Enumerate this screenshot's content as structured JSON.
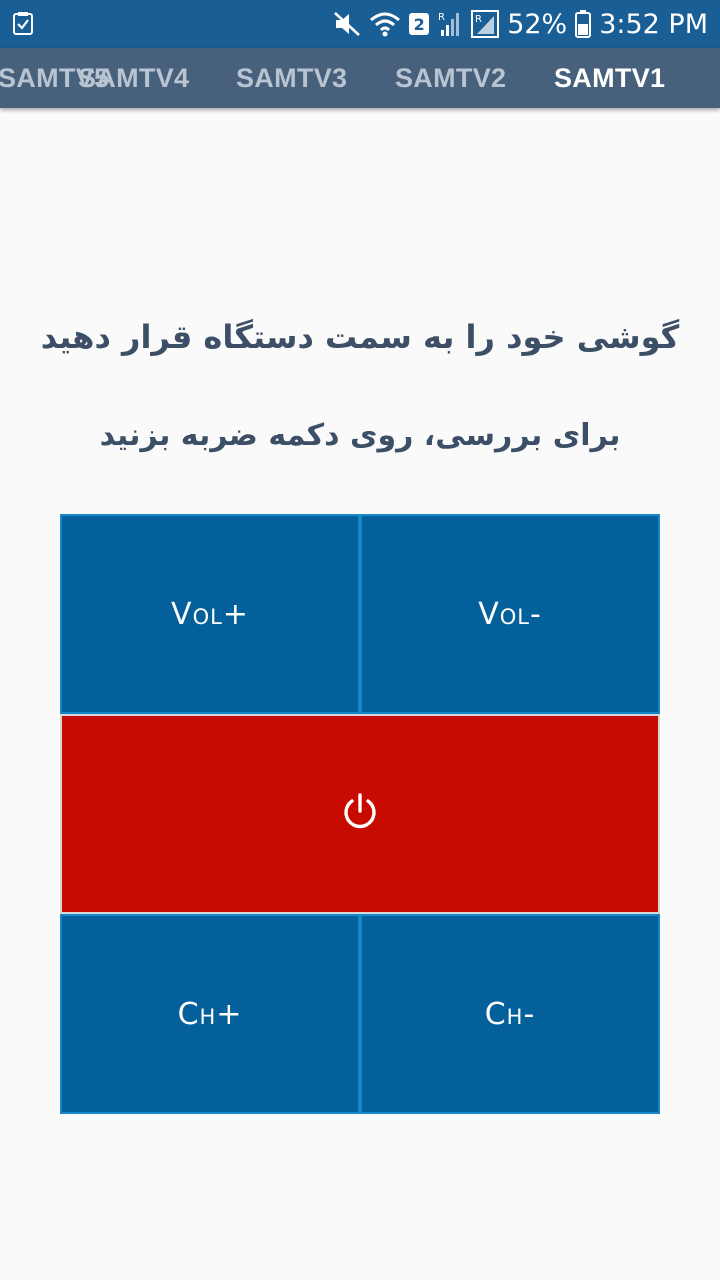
{
  "status_bar": {
    "left_icon": "clipboard-check-icon",
    "icons": [
      "mute-icon",
      "wifi-icon",
      "sim-2-badge",
      "signal-r-icon",
      "signal-r-icon",
      "battery-icon"
    ],
    "sim_badge": "2",
    "battery": "52%",
    "time": "3:52 PM"
  },
  "tabs": [
    {
      "label": "SAMTV5",
      "active": false
    },
    {
      "label": "SAMTV4",
      "active": false
    },
    {
      "label": "SAMTV3",
      "active": false
    },
    {
      "label": "SAMTV2",
      "active": false
    },
    {
      "label": "SAMTV1",
      "active": true
    }
  ],
  "instructions": {
    "line1": "گوشی خود را به سمت دستگاه قرار دهید",
    "line2": "برای بررسی، روی دکمه ضربه بزنید"
  },
  "remote": {
    "vol_plus": "Vol+",
    "vol_minus": "Vol-",
    "power_icon": "power-icon",
    "ch_plus": "Ch+",
    "ch_minus": "Ch-"
  },
  "colors": {
    "status_bar": "#1a5e96",
    "tab_bar": "#47607c",
    "button_blue": "#04609a",
    "button_border": "#1787c9",
    "power_red": "#c80b00",
    "instruction_text": "#3c4f66"
  }
}
